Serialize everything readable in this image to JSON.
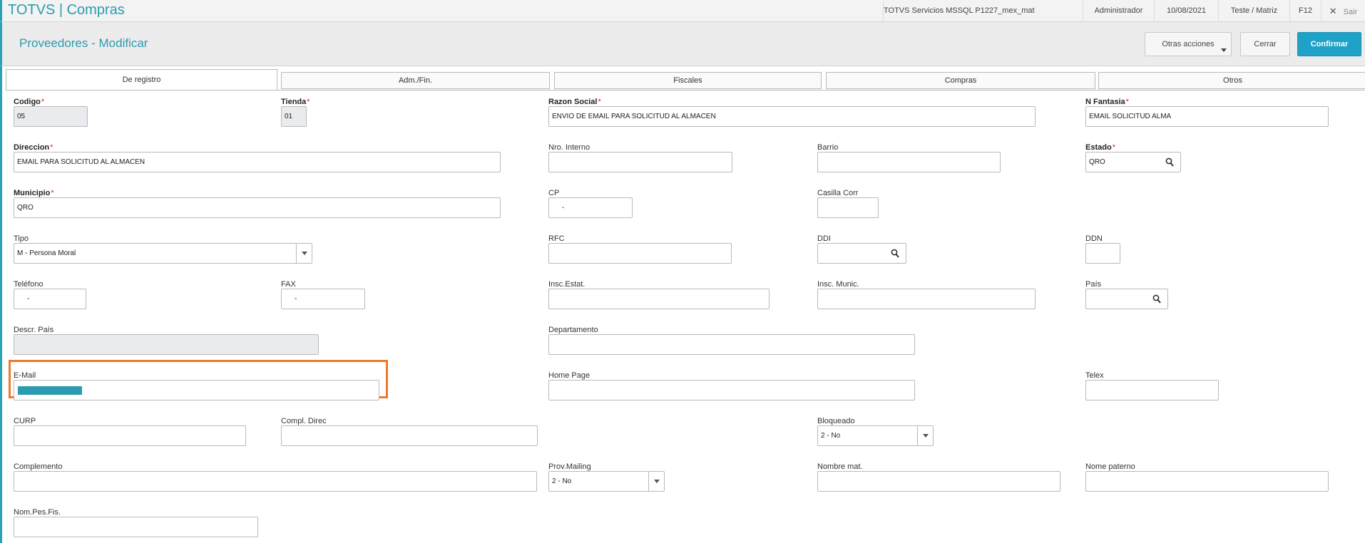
{
  "topbar": {
    "app_title": "TOTVS | Compras",
    "environment": "TOTVS Servicios MSSQL P1227_mex_mat",
    "user": "Administrador",
    "date": "10/08/2021",
    "branch": "Teste / Matriz",
    "f12": "F12",
    "exit_label": "Sair"
  },
  "header": {
    "title": "Proveedores - Modificar",
    "more_actions": "Otras acciones",
    "close": "Cerrar",
    "confirm": "Confirmar"
  },
  "tabs": [
    "De registro",
    "Adm./Fin.",
    "Fiscales",
    "Compras",
    "Otros"
  ],
  "fields": {
    "codigo": {
      "label": "Codigo",
      "value": "05"
    },
    "tienda": {
      "label": "Tienda",
      "value": "01"
    },
    "razon_social": {
      "label": "Razon Social",
      "value": "ENVIO DE EMAIL PARA SOLICITUD AL ALMACEN"
    },
    "n_fantasia": {
      "label": "N Fantasia",
      "value": "EMAIL SOLICITUD ALMA"
    },
    "direccion": {
      "label": "Direccion",
      "value": "EMAIL PARA SOLICITUD AL ALMACEN"
    },
    "nro_interno": {
      "label": "Nro. Interno",
      "value": ""
    },
    "barrio": {
      "label": "Barrio",
      "value": ""
    },
    "estado": {
      "label": "Estado",
      "value": "QRO"
    },
    "municipio": {
      "label": "Municipio",
      "value": "QRO"
    },
    "cp": {
      "label": "CP",
      "value": "-"
    },
    "casilla_corr": {
      "label": "Casilla Corr",
      "value": ""
    },
    "tipo": {
      "label": "Tipo",
      "value": "M - Persona Moral"
    },
    "rfc": {
      "label": "RFC",
      "value": ""
    },
    "ddi": {
      "label": "DDI",
      "value": ""
    },
    "ddn": {
      "label": "DDN",
      "value": ""
    },
    "telefono": {
      "label": "Teléfono",
      "value": "-"
    },
    "fax": {
      "label": "FAX",
      "value": "-"
    },
    "insc_estat": {
      "label": "Insc.Estat.",
      "value": ""
    },
    "insc_munic": {
      "label": "Insc. Munic.",
      "value": ""
    },
    "pais": {
      "label": "País",
      "value": ""
    },
    "descr_pais": {
      "label": "Descr. País",
      "value": ""
    },
    "departamento": {
      "label": "Departamento",
      "value": ""
    },
    "email": {
      "label": "E-Mail",
      "value": ""
    },
    "home_page": {
      "label": "Home Page",
      "value": ""
    },
    "telex": {
      "label": "Telex",
      "value": ""
    },
    "curp": {
      "label": "CURP",
      "value": ""
    },
    "compl_direc": {
      "label": "Compl. Direc",
      "value": ""
    },
    "bloqueado": {
      "label": "Bloqueado",
      "value": "2 - No"
    },
    "complemento": {
      "label": "Complemento",
      "value": ""
    },
    "prov_mailing": {
      "label": "Prov.Mailing",
      "value": "2 - No"
    },
    "nombre_mat": {
      "label": "Nombre mat.",
      "value": ""
    },
    "nome_paterno": {
      "label": "Nome paterno",
      "value": ""
    },
    "nom_pes_fis": {
      "label": "Nom.Pes.Fis.",
      "value": ""
    }
  },
  "colors": {
    "accent": "#2a9bb0",
    "confirm": "#1fa2c7",
    "highlight": "#ed7a2e",
    "required": "#dd2222"
  }
}
